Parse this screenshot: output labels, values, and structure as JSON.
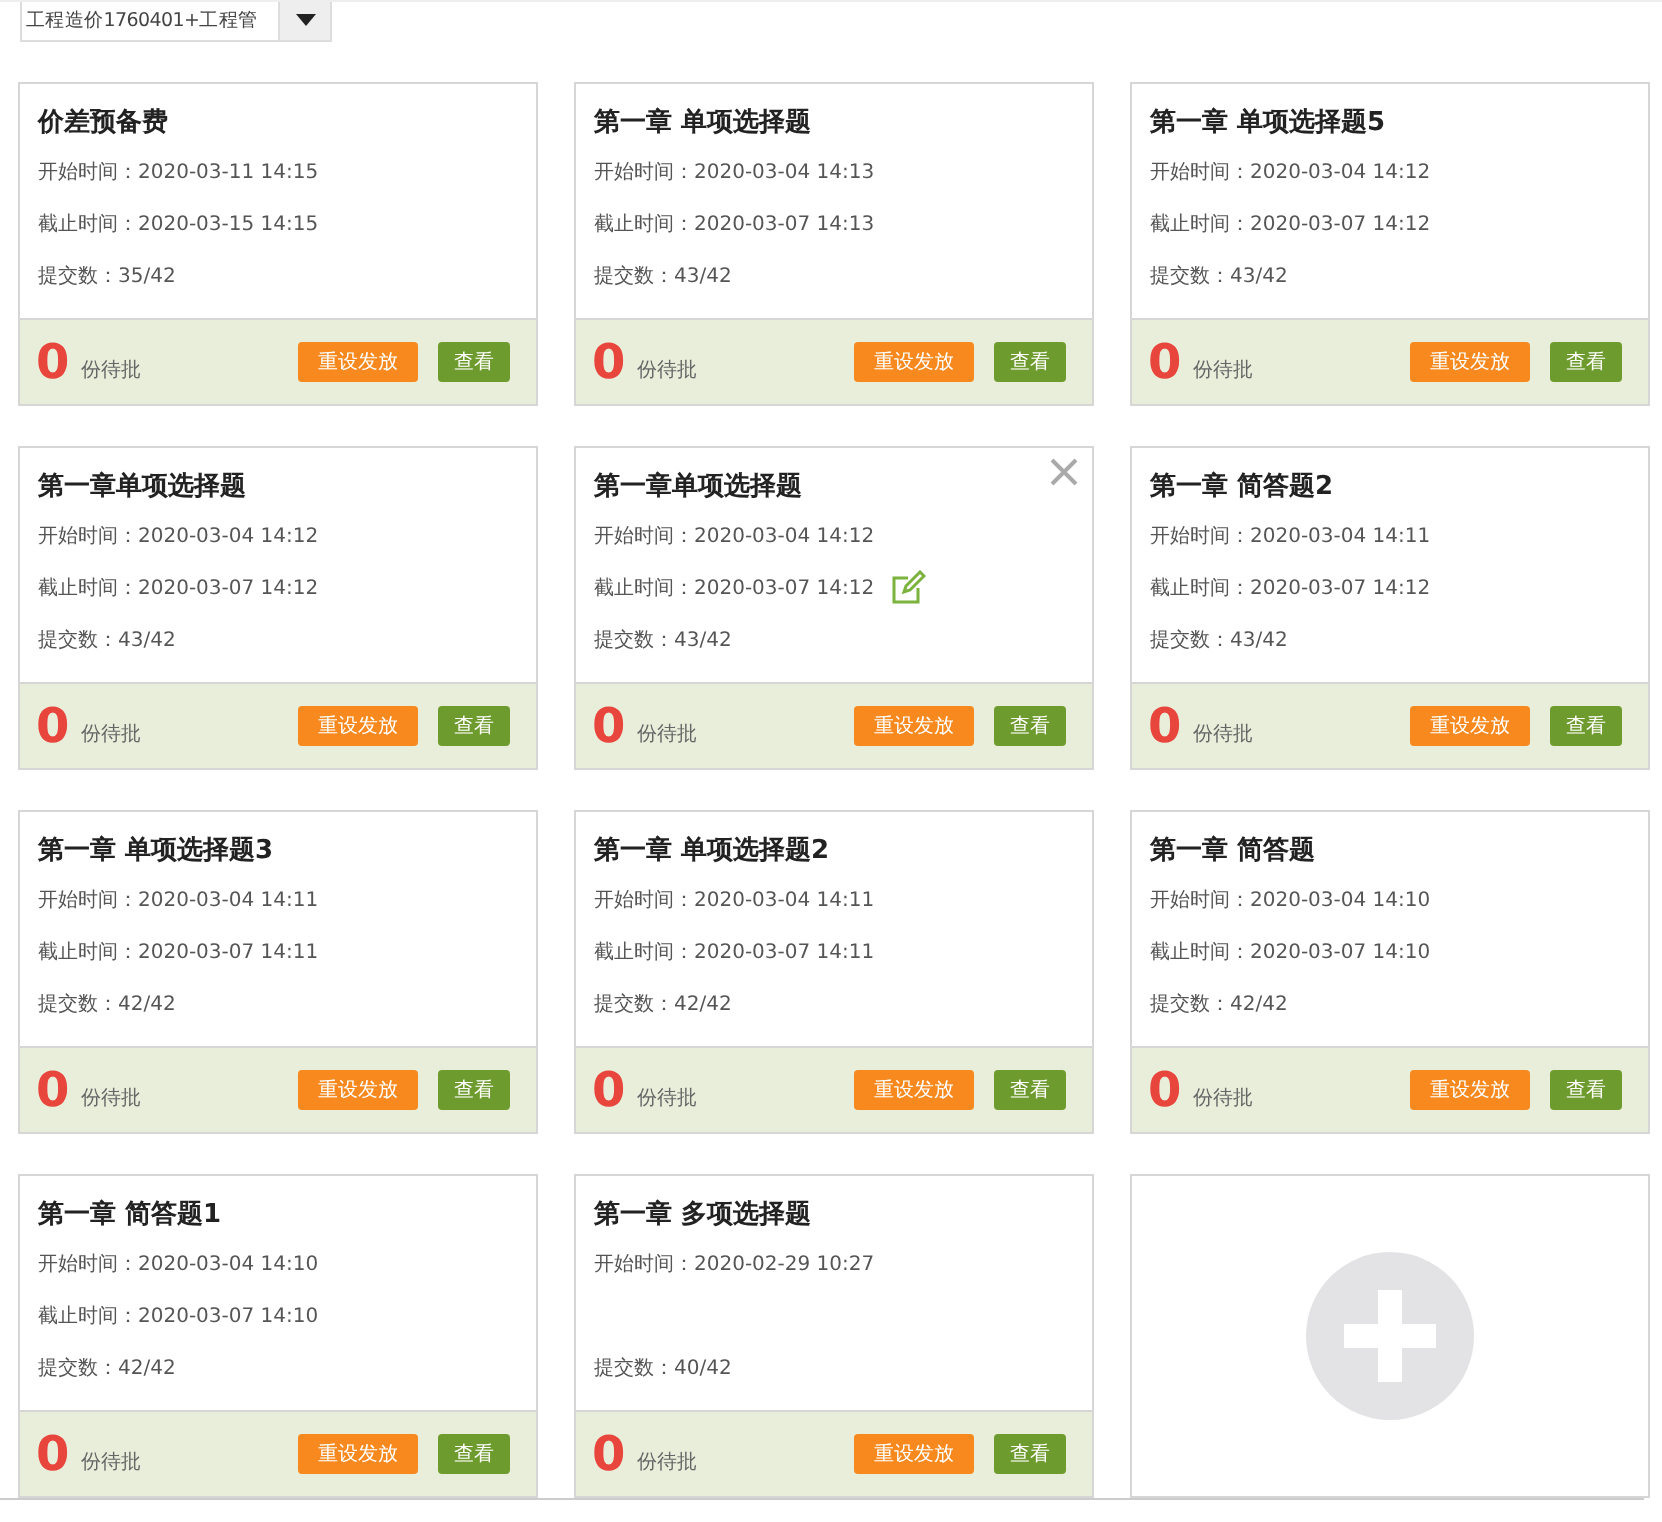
{
  "class_select": {
    "value": "工程造价1760401+工程管"
  },
  "cards": [
    {
      "kind": "task",
      "title": "价差预备费",
      "start_label": "开始时间：",
      "start": "2020-03-11 14:15",
      "end_label": "截止时间：",
      "end": "2020-03-15 14:15",
      "submit_label": "提交数：",
      "submit": "35/42",
      "pending": "0",
      "pending_label": "份待批",
      "reset": "重设发放",
      "view": "查看",
      "hovered": false
    },
    {
      "kind": "task",
      "title": "第一章 单项选择题",
      "start_label": "开始时间：",
      "start": "2020-03-04 14:13",
      "end_label": "截止时间：",
      "end": "2020-03-07 14:13",
      "submit_label": "提交数：",
      "submit": "43/42",
      "pending": "0",
      "pending_label": "份待批",
      "reset": "重设发放",
      "view": "查看",
      "hovered": false
    },
    {
      "kind": "task",
      "title": "第一章 单项选择题5",
      "start_label": "开始时间：",
      "start": "2020-03-04 14:12",
      "end_label": "截止时间：",
      "end": "2020-03-07 14:12",
      "submit_label": "提交数：",
      "submit": "43/42",
      "pending": "0",
      "pending_label": "份待批",
      "reset": "重设发放",
      "view": "查看",
      "hovered": false
    },
    {
      "kind": "task",
      "title": "第一章单项选择题",
      "start_label": "开始时间：",
      "start": "2020-03-04 14:12",
      "end_label": "截止时间：",
      "end": "2020-03-07 14:12",
      "submit_label": "提交数：",
      "submit": "43/42",
      "pending": "0",
      "pending_label": "份待批",
      "reset": "重设发放",
      "view": "查看",
      "hovered": false
    },
    {
      "kind": "task",
      "title": "第一章单项选择题",
      "start_label": "开始时间：",
      "start": "2020-03-04 14:12",
      "end_label": "截止时间：",
      "end": "2020-03-07 14:12",
      "submit_label": "提交数：",
      "submit": "43/42",
      "pending": "0",
      "pending_label": "份待批",
      "reset": "重设发放",
      "view": "查看",
      "hovered": true
    },
    {
      "kind": "task",
      "title": "第一章 简答题2",
      "start_label": "开始时间：",
      "start": "2020-03-04 14:11",
      "end_label": "截止时间：",
      "end": "2020-03-07 14:12",
      "submit_label": "提交数：",
      "submit": "43/42",
      "pending": "0",
      "pending_label": "份待批",
      "reset": "重设发放",
      "view": "查看",
      "hovered": false
    },
    {
      "kind": "task",
      "title": "第一章 单项选择题3",
      "start_label": "开始时间：",
      "start": "2020-03-04 14:11",
      "end_label": "截止时间：",
      "end": "2020-03-07 14:11",
      "submit_label": "提交数：",
      "submit": "42/42",
      "pending": "0",
      "pending_label": "份待批",
      "reset": "重设发放",
      "view": "查看",
      "hovered": false
    },
    {
      "kind": "task",
      "title": "第一章 单项选择题2",
      "start_label": "开始时间：",
      "start": "2020-03-04 14:11",
      "end_label": "截止时间：",
      "end": "2020-03-07 14:11",
      "submit_label": "提交数：",
      "submit": "42/42",
      "pending": "0",
      "pending_label": "份待批",
      "reset": "重设发放",
      "view": "查看",
      "hovered": false
    },
    {
      "kind": "task",
      "title": "第一章 简答题",
      "start_label": "开始时间：",
      "start": "2020-03-04 14:10",
      "end_label": "截止时间：",
      "end": "2020-03-07 14:10",
      "submit_label": "提交数：",
      "submit": "42/42",
      "pending": "0",
      "pending_label": "份待批",
      "reset": "重设发放",
      "view": "查看",
      "hovered": false
    },
    {
      "kind": "task",
      "title": "第一章 简答题1",
      "start_label": "开始时间：",
      "start": "2020-03-04 14:10",
      "end_label": "截止时间：",
      "end": "2020-03-07 14:10",
      "submit_label": "提交数：",
      "submit": "42/42",
      "pending": "0",
      "pending_label": "份待批",
      "reset": "重设发放",
      "view": "查看",
      "hovered": false
    },
    {
      "kind": "task",
      "title": "第一章 多项选择题",
      "start_label": "开始时间：",
      "start": "2020-02-29 10:27",
      "submit_label": "提交数：",
      "submit": "40/42",
      "pending": "0",
      "pending_label": "份待批",
      "reset": "重设发放",
      "view": "查看",
      "hovered": false
    },
    {
      "kind": "add"
    }
  ]
}
